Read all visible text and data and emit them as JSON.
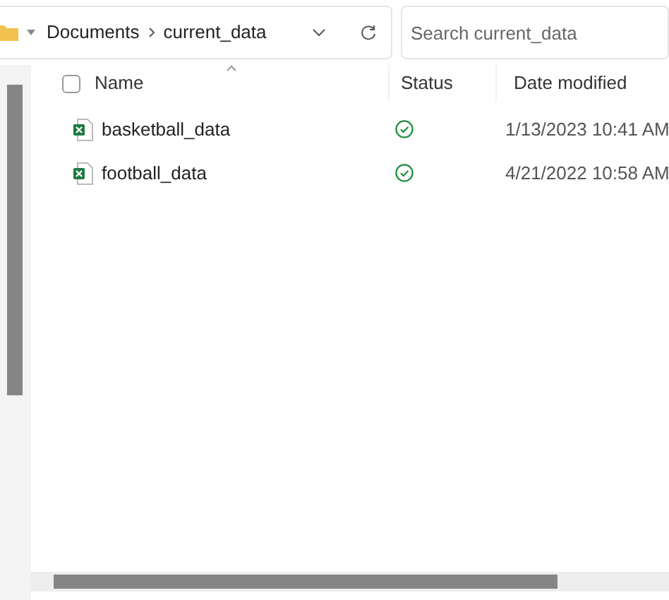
{
  "address_bar": {
    "path": [
      "Documents",
      "current_data"
    ]
  },
  "search": {
    "placeholder": "Search current_data"
  },
  "table": {
    "select_all": {
      "checked": false
    },
    "columns": [
      "Name",
      "Status",
      "Date modified"
    ],
    "rows": [
      {
        "name": "basketball_data",
        "kind": "synced",
        "date": "1/13/2023 10:41 AM"
      },
      {
        "name": "football_data",
        "kind": "synced",
        "date": "4/21/2022 10:58 AM"
      }
    ]
  }
}
